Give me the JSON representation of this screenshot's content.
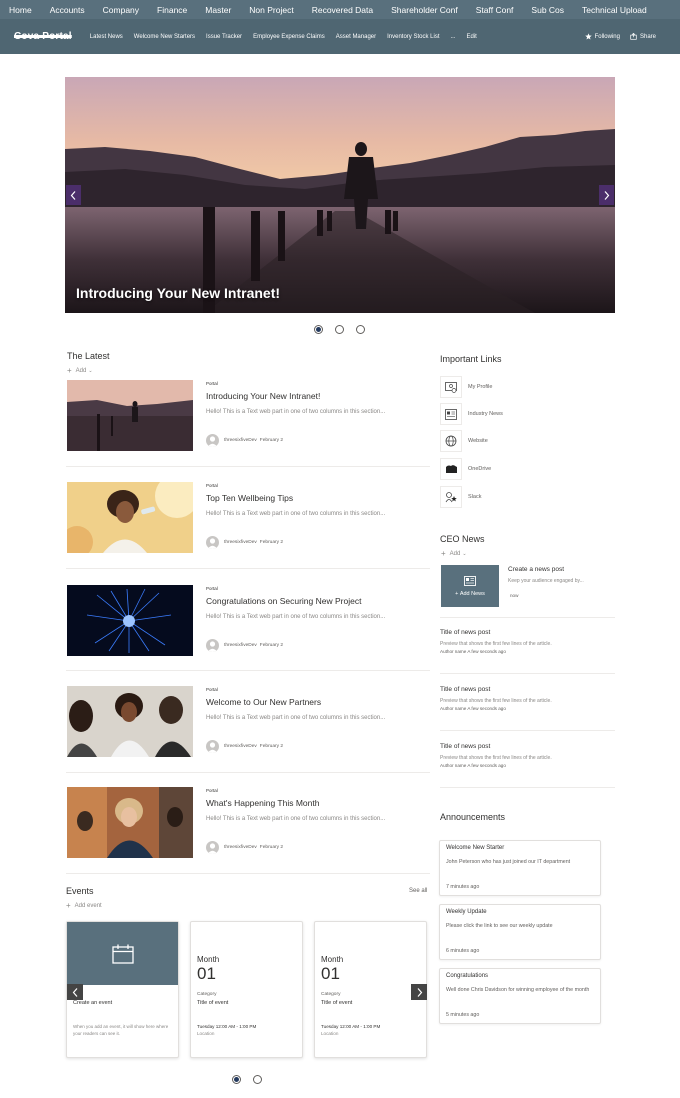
{
  "top_nav": [
    "Home",
    "Accounts",
    "Company",
    "Finance",
    "Master",
    "Non Project",
    "Recovered Data",
    "Shareholder Conf",
    "Staff Conf",
    "Sub Cos",
    "Technical Upload"
  ],
  "site": {
    "title": "Cova Portal",
    "nav": [
      "Latest News",
      "Welcome New Starters",
      "Issue Tracker",
      "Employee Expense Claims",
      "Asset Manager",
      "Inventory Stock List",
      "...",
      "Edit"
    ],
    "following_label": "Following",
    "share_label": "Share"
  },
  "hero": {
    "title": "Introducing Your New Intranet!",
    "slide_count": 3,
    "active_slide": 1
  },
  "latest": {
    "title": "The Latest",
    "add_label": "Add",
    "items": [
      {
        "category": "Portal",
        "title": "Introducing Your New Intranet!",
        "description": "Hello! This is a Text web part in one of two columns in this section...",
        "author": "threesixfiveDev",
        "date": "February 2"
      },
      {
        "category": "Portal",
        "title": "Top Ten Wellbeing Tips",
        "description": "Hello! This is a Text web part in one of two columns in this section...",
        "author": "threesixfiveDev",
        "date": "February 2"
      },
      {
        "category": "Portal",
        "title": "Congratulations on Securing New Project",
        "description": "Hello! This is a Text web part in one of two columns in this section...",
        "author": "threesixfiveDev",
        "date": "February 2"
      },
      {
        "category": "Portal",
        "title": "Welcome to Our New Partners",
        "description": "Hello! This is a Text web part in one of two columns in this section...",
        "author": "threesixfiveDev",
        "date": "February 2"
      },
      {
        "category": "Portal",
        "title": "What's Happening This Month",
        "description": "Hello! This is a Text web part in one of two columns in this section...",
        "author": "threesixfiveDev",
        "date": "February 2"
      }
    ]
  },
  "important_links": {
    "title": "Important Links",
    "items": [
      {
        "label": "My Profile",
        "icon": "profile-card-icon"
      },
      {
        "label": "Industry News",
        "icon": "news-icon"
      },
      {
        "label": "Website",
        "icon": "globe-icon"
      },
      {
        "label": "OneDrive",
        "icon": "onedrive-icon"
      },
      {
        "label": "Slack",
        "icon": "slack-icon"
      }
    ]
  },
  "ceo_news": {
    "title": "CEO News",
    "add_label": "Add",
    "add_news_label": "Add News",
    "create_title": "Create a news post",
    "create_desc": "Keep your audience engaged by...",
    "create_time": "now",
    "posts": [
      {
        "title": "Title of news post",
        "preview": "Preview that shows the first few lines of the article.",
        "author": "Author name",
        "time": "A few seconds ago"
      },
      {
        "title": "Title of news post",
        "preview": "Preview that shows the first few lines of the article.",
        "author": "Author name",
        "time": "A few seconds ago"
      },
      {
        "title": "Title of news post",
        "preview": "Preview that shows the first few lines of the article.",
        "author": "Author name",
        "time": "A few seconds ago"
      }
    ]
  },
  "announcements": {
    "title": "Announcements",
    "items": [
      {
        "title": "Welcome New Starter",
        "body": "John Peterson who has just joined our IT department",
        "time": "7 minutes ago"
      },
      {
        "title": "Weekly Update",
        "body": "Please click the link to see our weekly update",
        "time": "6 minutes ago"
      },
      {
        "title": "Congratulations",
        "body": "Well done Chris Davidson for winning employee of the month",
        "time": "5 minutes ago"
      }
    ]
  },
  "events": {
    "title": "Events",
    "see_all": "See all",
    "add_label": "Add event",
    "create_title": "Create an event",
    "create_desc": "When you add an event, it will show here where your readers can see it.",
    "cards": [
      {
        "month": "Month",
        "day": "01",
        "category": "Category",
        "title": "Title of event",
        "time": "Tuesday 12:00 AM - 1:00 PM",
        "location": "Location"
      },
      {
        "month": "Month",
        "day": "01",
        "category": "Category",
        "title": "Title of event",
        "time": "Tuesday 12:00 AM - 1:00 PM",
        "location": "Location"
      }
    ],
    "page_count": 2,
    "active_page": 1
  },
  "colors": {
    "topbar": "#59707d",
    "subbar": "#4f6672",
    "accent": "#243a5e",
    "tile": "#59707d"
  }
}
